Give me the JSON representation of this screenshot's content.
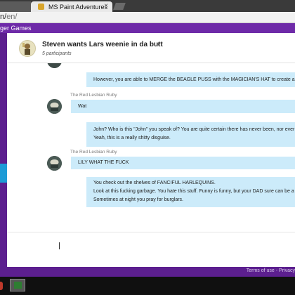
{
  "browser": {
    "tab_title": "MS Paint Adventures",
    "tab_close": "×",
    "url_main": "n/",
    "url_tail": "en/",
    "bookmark": "ger Games"
  },
  "conversation": {
    "title": "Steven wants Lars weenie in da butt",
    "caret": "▾",
    "participants": "5 participants"
  },
  "messages": [
    {
      "sender": "",
      "text": [
        "However, you are able to MERGE the BEAGLE PUSS with the MAGICIAN'S HAT to create a CL"
      ]
    },
    {
      "sender": "The Red Lesbian Ruby",
      "text": [
        "Wat"
      ]
    },
    {
      "sender": "",
      "text": [
        "John? Who is this \"John\" you speak of? You are quite certain there has never been, nor ever",
        "Yeah, this is a really shitty disguise."
      ]
    },
    {
      "sender": "The Red Lesbian Ruby",
      "text": [
        "LILY WHAT THE FUCK"
      ]
    },
    {
      "sender": "",
      "text": [
        "You check out the shelves of FANCIFUL HARLEQUINS.",
        "Look at this fucking garbage. You hate this stuff. Funny is funny, but your DAD sure can be a",
        "Sometimes at night you pray for burglars."
      ]
    }
  ],
  "footer": {
    "links": "Terms of use  -  Privacy"
  },
  "colors": {
    "accent_purple": "#5c1f8f",
    "bubble_blue": "#ccebfa",
    "sidebar_accent": "#1d9bd6"
  }
}
